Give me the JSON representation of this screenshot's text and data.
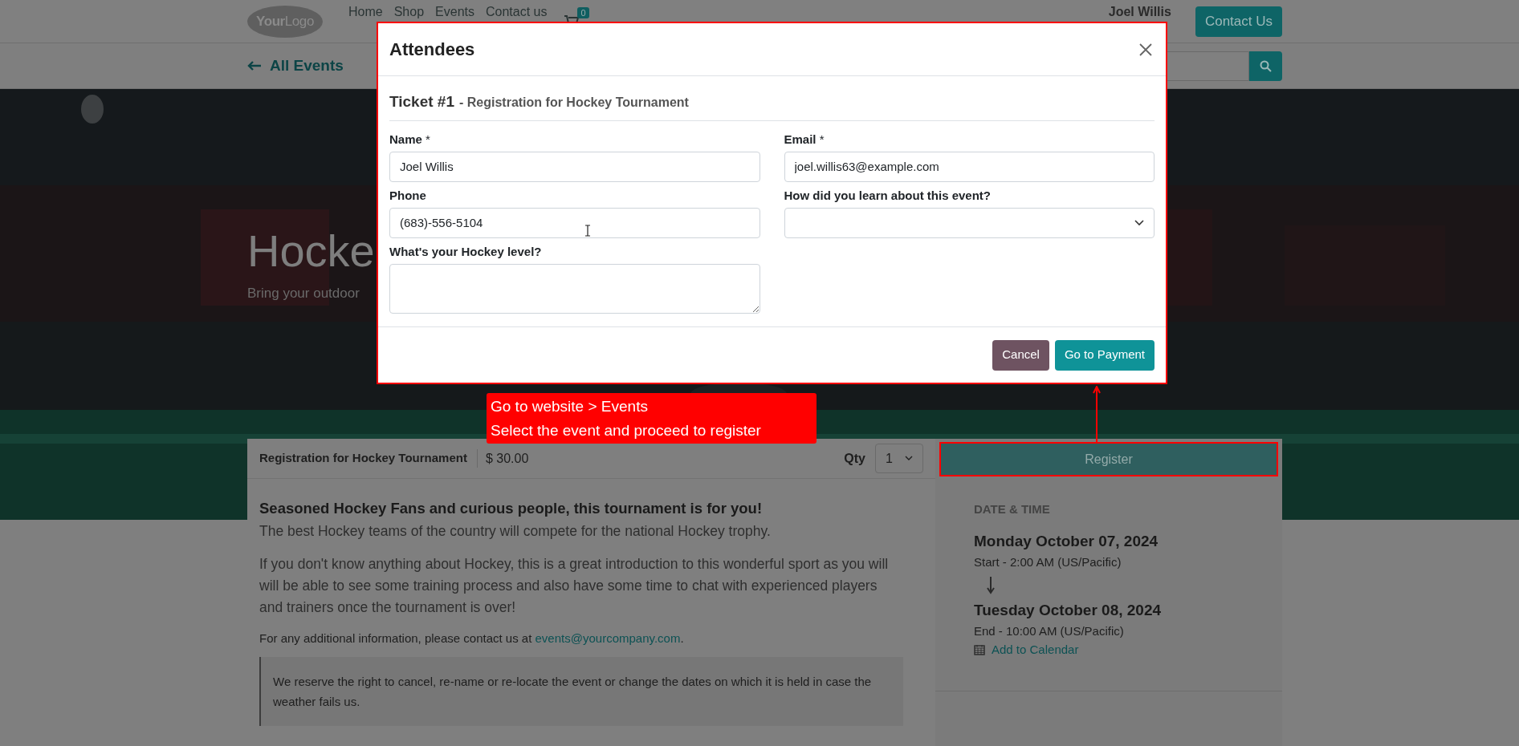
{
  "nav": {
    "logo": "**Your**Logo",
    "menu": [
      {
        "label": "Home"
      },
      {
        "label": "Shop"
      },
      {
        "label": "Events"
      },
      {
        "label": "Contact us"
      }
    ],
    "cart_count": "0",
    "user": "Joel Willis",
    "cta": "Contact Us"
  },
  "subnav": {
    "back_label": "All Events"
  },
  "hero": {
    "title": "Hocke",
    "subtitle": "Bring your outdoor"
  },
  "registration": {
    "ticket": "Registration for Hockey Tournament",
    "price": "$ 30.00",
    "qty_label": "Qty",
    "qty": "1",
    "register": "Register"
  },
  "description": {
    "heading": "Seasoned Hockey Fans and curious people, this tournament is for you!",
    "paragraphs": [
      "The best Hockey teams of the country will compete for the national Hockey trophy.",
      "If you don't know anything about Hockey, this is a great introduction to this wonderful sport as you will will be able to see some training process and also have some time to chat with experienced players and trainers once the tournament is over!"
    ],
    "contact": "For any additional information, please contact us at ",
    "contact_link": "events@yourcompany.com",
    "contact_end": ".",
    "note": "We reserve the right to cancel, re-name or re-locate the event or change the dates on which it is held in case the weather fails us."
  },
  "date_time": {
    "label": "DATE & TIME",
    "start_date": "Monday October 07, 2024",
    "start_time": "Start - 2:00 AM (US/Pacific)",
    "end_date": "Tuesday October 08, 2024",
    "end_time": "End - 10:00 AM (US/Pacific)",
    "calendar_link": "Add to Calendar"
  },
  "modal": {
    "title": "Attendees",
    "ticket_heading": "Ticket #1",
    "ticket_name": "- Registration for Hockey Tournament",
    "fields": [
      {
        "kind": "text",
        "label": "**Name** *",
        "value": "Joel Willis"
      },
      {
        "kind": "text",
        "label": "**Email** *",
        "value": "joel.willis63@example.com"
      },
      {
        "kind": "text",
        "label": "**Phone**",
        "value": "(683)-556-5104"
      },
      {
        "kind": "select",
        "label": "**How did you learn about this event?**"
      },
      {
        "kind": "textarea",
        "label": "**What's your Hockey level?**"
      }
    ],
    "buttons": [
      {
        "kind": "secondary",
        "label": "Cancel"
      },
      {
        "kind": "primary",
        "label": "Go to Payment"
      }
    ]
  },
  "annotation": {
    "lines": [
      "Go to website > Events",
      "Select the event and proceed to register"
    ]
  }
}
